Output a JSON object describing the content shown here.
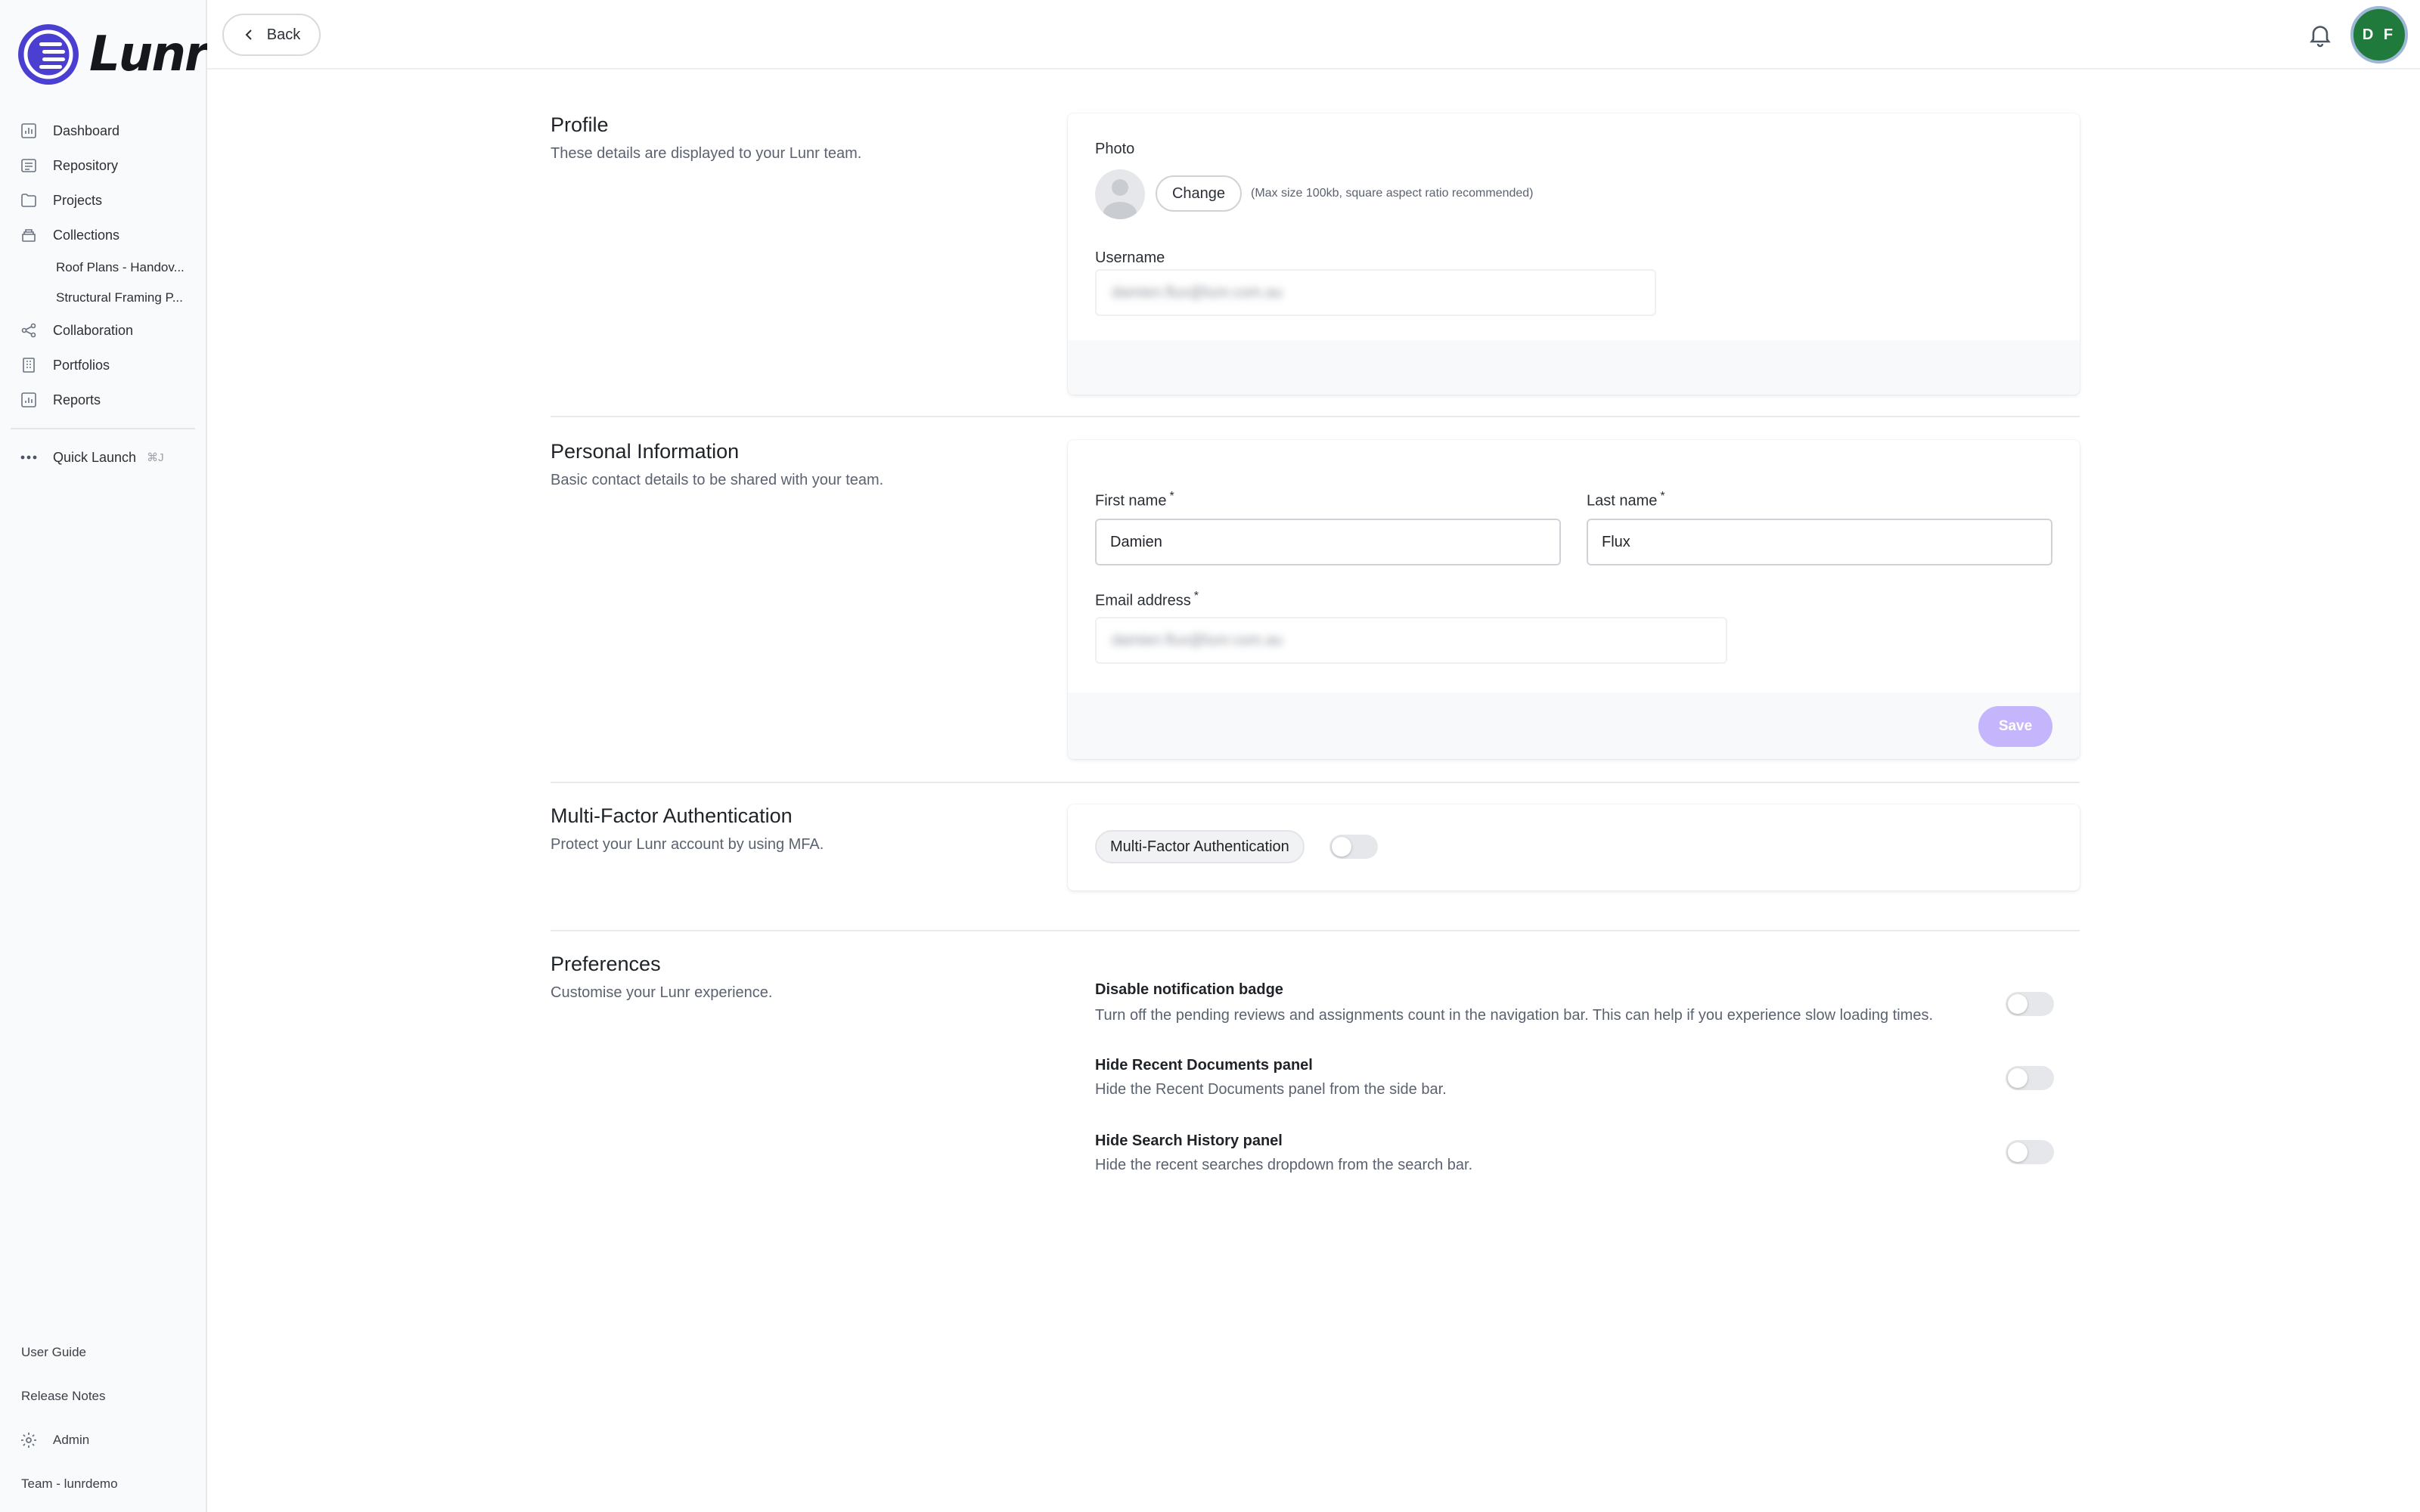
{
  "app": {
    "name": "Lunr"
  },
  "sidebar": {
    "items": [
      {
        "label": "Dashboard",
        "icon": "dashboard-icon"
      },
      {
        "label": "Repository",
        "icon": "repository-icon"
      },
      {
        "label": "Projects",
        "icon": "folder-icon"
      },
      {
        "label": "Collections",
        "icon": "collections-icon"
      }
    ],
    "collections": [
      {
        "label": "Roof Plans - Handov..."
      },
      {
        "label": "Structural Framing P..."
      }
    ],
    "items2": [
      {
        "label": "Collaboration",
        "icon": "share-icon"
      },
      {
        "label": "Portfolios",
        "icon": "building-icon"
      },
      {
        "label": "Reports",
        "icon": "chart-icon"
      }
    ],
    "quick_launch": {
      "label": "Quick Launch",
      "shortcut": "⌘J"
    },
    "bottom": {
      "user_guide": "User Guide",
      "release_notes": "Release Notes",
      "admin": "Admin",
      "team": "Team - lunrdemo"
    }
  },
  "topbar": {
    "back_label": "Back",
    "avatar_initials": "D F"
  },
  "profile": {
    "title": "Profile",
    "description": "These details are displayed to your Lunr team.",
    "photo_label": "Photo",
    "change_label": "Change",
    "photo_hint": "(Max size 100kb, square aspect ratio recommended)",
    "username_label": "Username",
    "username_value": "damien.flux@lunr.com.au"
  },
  "personal": {
    "title": "Personal Information",
    "description": "Basic contact details to be shared with your team.",
    "first_name_label": "First name",
    "first_name_value": "Damien",
    "last_name_label": "Last name",
    "last_name_value": "Flux",
    "email_label": "Email address",
    "email_value": "damien.flux@lunr.com.au",
    "required_mark": "*",
    "save_label": "Save"
  },
  "mfa": {
    "title": "Multi-Factor Authentication",
    "description": "Protect your Lunr account by using MFA.",
    "chip_label": "Multi-Factor Authentication",
    "enabled": false
  },
  "preferences": {
    "title": "Preferences",
    "description": "Customise your Lunr experience.",
    "items": [
      {
        "title": "Disable notification badge",
        "description": "Turn off the pending reviews and assignments count in the navigation bar. This can help if you experience slow loading times.",
        "enabled": false
      },
      {
        "title": "Hide Recent Documents panel",
        "description": "Hide the Recent Documents panel from the side bar.",
        "enabled": false
      },
      {
        "title": "Hide Search History panel",
        "description": "Hide the recent searches dropdown from the search bar.",
        "enabled": false
      }
    ]
  },
  "colors": {
    "accent": "#4b3fd1",
    "avatar_bg": "#1f7a3b",
    "save_disabled": "#c4b5fd"
  }
}
